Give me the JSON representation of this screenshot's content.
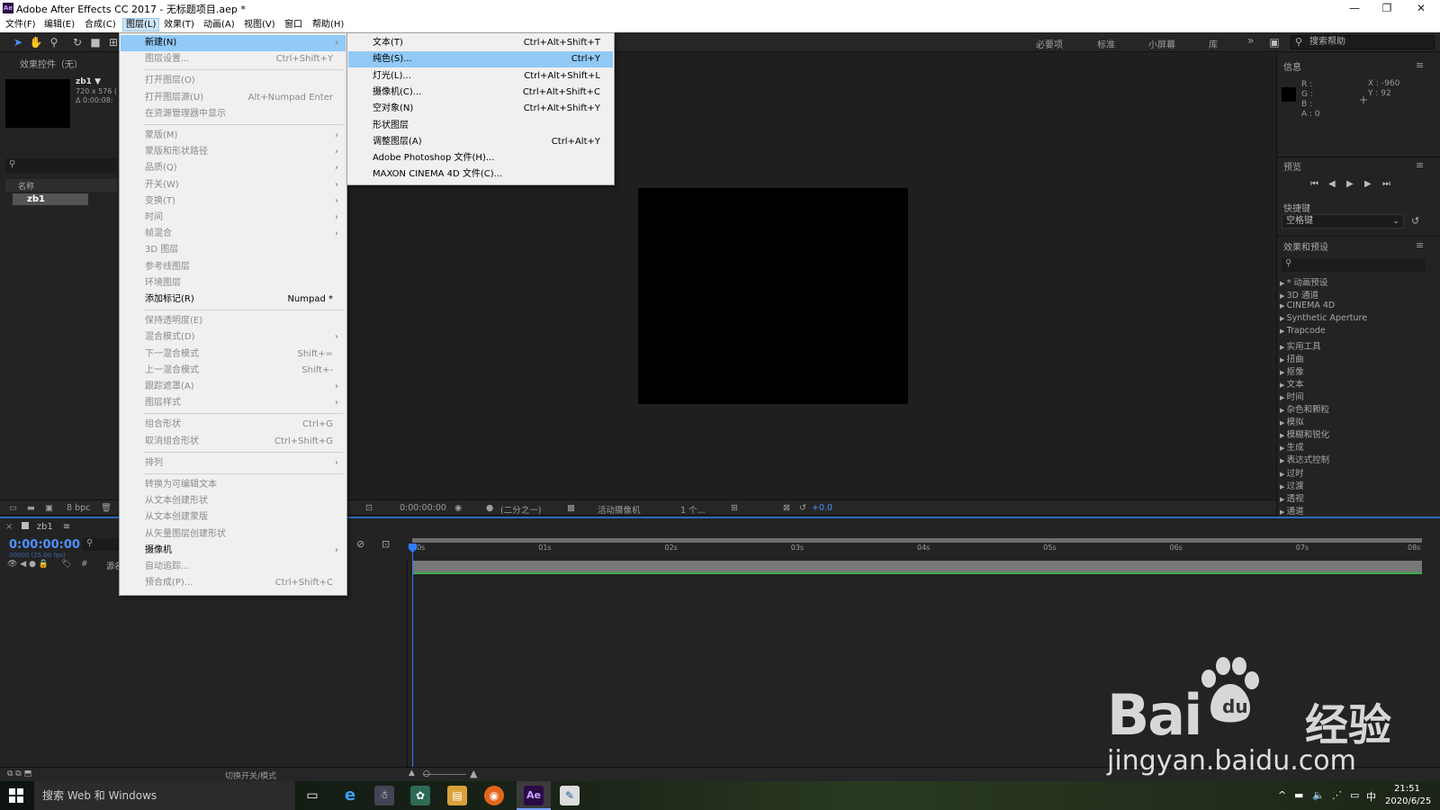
{
  "window": {
    "title": "Adobe After Effects CC 2017 - 无标题项目.aep *",
    "logo_text": "Ae",
    "minimize": "—",
    "maximize": "❐",
    "close": "✕"
  },
  "menubar": [
    "文件(F)",
    "编辑(E)",
    "合成(C)",
    "图层(L)",
    "效果(T)",
    "动画(A)",
    "视图(V)",
    "窗口",
    "帮助(H)"
  ],
  "workspace_tabs": [
    "必要项",
    "标准",
    "小屏幕",
    "库"
  ],
  "workspace_more": "»",
  "help_search_placeholder": "搜索帮助",
  "effect_controls_title": "效果控件（无）",
  "project": {
    "item_name": "zb1 ▼",
    "item_size": "720 x 576 (",
    "item_duration": "Δ 0:00:08:",
    "column_name": "名称",
    "row_name": "zb1",
    "bpc": "8 bpc"
  },
  "info_panel": {
    "title": "信息",
    "r": "R :",
    "g": "G :",
    "b": "B :",
    "a": "A : 0",
    "x": "X : -960",
    "y": "Y : 92"
  },
  "preview_panel": {
    "title": "预览",
    "shortcut_label": "快捷键",
    "shortcut_value": "空格键"
  },
  "effects_panel": {
    "title": "效果和预设",
    "items": [
      "* 动画预设",
      "3D 通道",
      "CINEMA 4D",
      "Synthetic Aperture",
      "Trapcode",
      "实用工具",
      "扭曲",
      "抠像",
      "文本",
      "时间",
      "杂色和颗粒",
      "模拟",
      "模糊和锐化",
      "生成",
      "表达式控制",
      "过时",
      "过渡",
      "透视",
      "通道"
    ]
  },
  "viewer_bar": {
    "time": "0:00:00:00",
    "resolution": "(二分之一)",
    "camera": "活动摄像机",
    "views": "1 个...",
    "exposure": "+0.0"
  },
  "timeline": {
    "tab": "zb1",
    "current_time": "0:00:00:00",
    "fps": "00000 (25.00 fps)",
    "ticks": [
      "00s",
      "01s",
      "02s",
      "03s",
      "04s",
      "05s",
      "06s",
      "07s",
      "08s"
    ],
    "source_col": "源名",
    "footer_toggle": "切换开关/模式"
  },
  "layer_menu": {
    "items": [
      {
        "label": "新建(N)",
        "shortcut": "",
        "submenu": true,
        "disabled": false,
        "highlight": true
      },
      {
        "label": "图层设置...",
        "shortcut": "Ctrl+Shift+Y",
        "submenu": false,
        "disabled": true
      },
      {
        "sep": true
      },
      {
        "label": "打开图层(O)",
        "shortcut": "",
        "submenu": false,
        "disabled": true
      },
      {
        "label": "打开图层源(U)",
        "shortcut": "Alt+Numpad Enter",
        "submenu": false,
        "disabled": true
      },
      {
        "label": "在资源管理器中显示",
        "shortcut": "",
        "submenu": false,
        "disabled": true
      },
      {
        "sep": true
      },
      {
        "label": "蒙版(M)",
        "shortcut": "",
        "submenu": true,
        "disabled": true
      },
      {
        "label": "蒙版和形状路径",
        "shortcut": "",
        "submenu": true,
        "disabled": true
      },
      {
        "label": "品质(Q)",
        "shortcut": "",
        "submenu": true,
        "disabled": true
      },
      {
        "label": "开关(W)",
        "shortcut": "",
        "submenu": true,
        "disabled": true
      },
      {
        "label": "变换(T)",
        "shortcut": "",
        "submenu": true,
        "disabled": true
      },
      {
        "label": "时间",
        "shortcut": "",
        "submenu": true,
        "disabled": true
      },
      {
        "label": "帧混合",
        "shortcut": "",
        "submenu": true,
        "disabled": true
      },
      {
        "label": "3D 图层",
        "shortcut": "",
        "submenu": false,
        "disabled": true
      },
      {
        "label": "参考线图层",
        "shortcut": "",
        "submenu": false,
        "disabled": true
      },
      {
        "label": "环境图层",
        "shortcut": "",
        "submenu": false,
        "disabled": true
      },
      {
        "label": "添加标记(R)",
        "shortcut": "Numpad *",
        "submenu": false,
        "disabled": false
      },
      {
        "sep": true
      },
      {
        "label": "保持透明度(E)",
        "shortcut": "",
        "submenu": false,
        "disabled": true
      },
      {
        "label": "混合模式(D)",
        "shortcut": "",
        "submenu": true,
        "disabled": true
      },
      {
        "label": "下一混合模式",
        "shortcut": "Shift+=",
        "submenu": false,
        "disabled": true
      },
      {
        "label": "上一混合模式",
        "shortcut": "Shift+-",
        "submenu": false,
        "disabled": true
      },
      {
        "label": "跟踪遮罩(A)",
        "shortcut": "",
        "submenu": true,
        "disabled": true
      },
      {
        "label": "图层样式",
        "shortcut": "",
        "submenu": true,
        "disabled": true
      },
      {
        "sep": true
      },
      {
        "label": "组合形状",
        "shortcut": "Ctrl+G",
        "submenu": false,
        "disabled": true
      },
      {
        "label": "取消组合形状",
        "shortcut": "Ctrl+Shift+G",
        "submenu": false,
        "disabled": true
      },
      {
        "sep": true
      },
      {
        "label": "排列",
        "shortcut": "",
        "submenu": true,
        "disabled": true
      },
      {
        "sep": true
      },
      {
        "label": "转换为可编辑文本",
        "shortcut": "",
        "submenu": false,
        "disabled": true
      },
      {
        "label": "从文本创建形状",
        "shortcut": "",
        "submenu": false,
        "disabled": true
      },
      {
        "label": "从文本创建蒙版",
        "shortcut": "",
        "submenu": false,
        "disabled": true
      },
      {
        "label": "从矢量图层创建形状",
        "shortcut": "",
        "submenu": false,
        "disabled": true
      },
      {
        "label": "摄像机",
        "shortcut": "",
        "submenu": true,
        "disabled": false
      },
      {
        "label": "自动追踪...",
        "shortcut": "",
        "submenu": false,
        "disabled": true
      },
      {
        "label": "预合成(P)...",
        "shortcut": "Ctrl+Shift+C",
        "submenu": false,
        "disabled": true
      }
    ]
  },
  "new_submenu": {
    "items": [
      {
        "label": "文本(T)",
        "shortcut": "Ctrl+Alt+Shift+T",
        "highlight": false
      },
      {
        "label": "纯色(S)...",
        "shortcut": "Ctrl+Y",
        "highlight": true
      },
      {
        "label": "灯光(L)...",
        "shortcut": "Ctrl+Alt+Shift+L",
        "highlight": false
      },
      {
        "label": "摄像机(C)...",
        "shortcut": "Ctrl+Alt+Shift+C",
        "highlight": false
      },
      {
        "label": "空对象(N)",
        "shortcut": "Ctrl+Alt+Shift+Y",
        "highlight": false
      },
      {
        "label": "形状图层",
        "shortcut": "",
        "highlight": false
      },
      {
        "label": "调整图层(A)",
        "shortcut": "Ctrl+Alt+Y",
        "highlight": false
      },
      {
        "label": "Adobe Photoshop 文件(H)...",
        "shortcut": "",
        "highlight": false
      },
      {
        "label": "MAXON CINEMA 4D 文件(C)...",
        "shortcut": "",
        "highlight": false
      }
    ]
  },
  "taskbar": {
    "search_placeholder": "搜索 Web 和 Windows",
    "ae_label": "Ae",
    "ime": "中",
    "time": "21:51",
    "date": "2020/6/25"
  },
  "watermark": {
    "brand": "Bai",
    "brand_suffix": "经验",
    "url": "jingyan.baidu.com"
  }
}
